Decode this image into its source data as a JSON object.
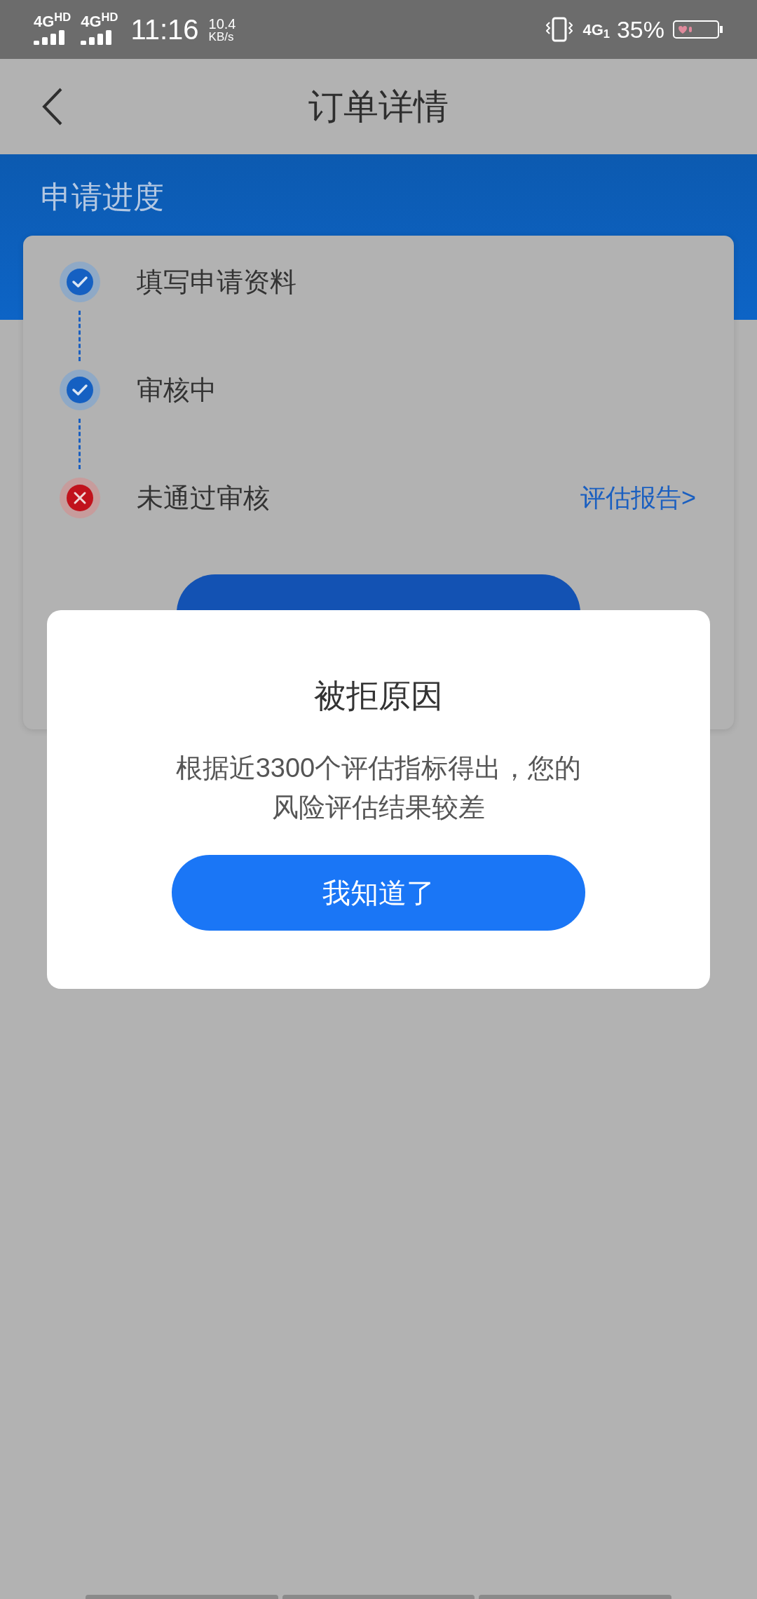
{
  "status_bar": {
    "sims": [
      "4G$^{HD}$",
      "4G$^{HD}$"
    ],
    "time": "11:16",
    "speed": "10.4",
    "speed_unit": "KB/s",
    "network": "4G$_{1}$",
    "battery": "35%"
  },
  "header": {
    "title": "订单详情"
  },
  "progress": {
    "title": "申请进度",
    "steps": [
      {
        "label": "填写申请资料",
        "kind": "done"
      },
      {
        "label": "审核中",
        "kind": "done"
      },
      {
        "label": "未通过审核",
        "kind": "failed",
        "link": "评估报告>"
      }
    ]
  },
  "dialog": {
    "title": "被拒原因",
    "message_lines": [
      "根据近3300个评估指标得出，您的",
      "风险评估结果较差"
    ],
    "button": "我知道了"
  }
}
